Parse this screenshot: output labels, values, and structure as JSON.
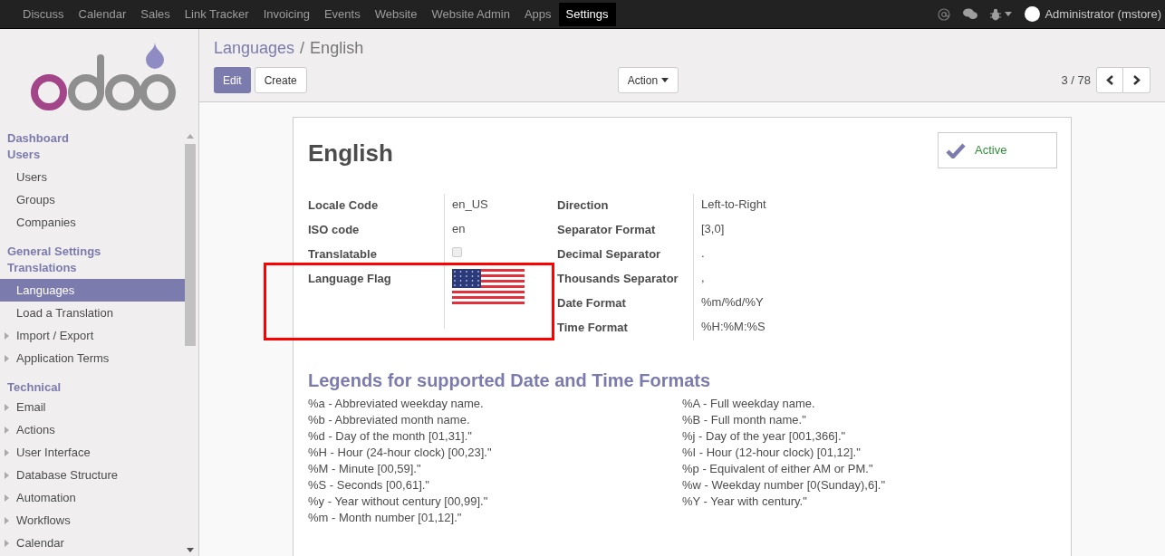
{
  "top_menu": [
    {
      "label": "Discuss",
      "selected": false
    },
    {
      "label": "Calendar",
      "selected": false
    },
    {
      "label": "Sales",
      "selected": false
    },
    {
      "label": "Link Tracker",
      "selected": false
    },
    {
      "label": "Invoicing",
      "selected": false
    },
    {
      "label": "Events",
      "selected": false
    },
    {
      "label": "Website",
      "selected": false
    },
    {
      "label": "Website Admin",
      "selected": false
    },
    {
      "label": "Apps",
      "selected": false
    },
    {
      "label": "Settings",
      "selected": true
    }
  ],
  "user": {
    "name": "Administrator (mstore)"
  },
  "sidebar": {
    "items": [
      {
        "kind": "header",
        "label": "Dashboard",
        "selected": false
      },
      {
        "kind": "header",
        "label": "Users",
        "selected": false
      },
      {
        "kind": "item",
        "label": "Users",
        "selected": false
      },
      {
        "kind": "item",
        "label": "Groups",
        "selected": false
      },
      {
        "kind": "item",
        "label": "Companies",
        "selected": false
      },
      {
        "kind": "header",
        "label": "General Settings",
        "selected": false
      },
      {
        "kind": "header",
        "label": "Translations",
        "selected": false
      },
      {
        "kind": "item",
        "label": "Languages",
        "selected": true
      },
      {
        "kind": "item",
        "label": "Load a Translation",
        "selected": false
      },
      {
        "kind": "folder",
        "label": "Import / Export",
        "selected": false
      },
      {
        "kind": "folder",
        "label": "Application Terms",
        "selected": false
      },
      {
        "kind": "header",
        "label": "Technical",
        "selected": false
      },
      {
        "kind": "folder",
        "label": "Email",
        "selected": false
      },
      {
        "kind": "folder",
        "label": "Actions",
        "selected": false
      },
      {
        "kind": "folder",
        "label": "User Interface",
        "selected": false
      },
      {
        "kind": "folder",
        "label": "Database Structure",
        "selected": false
      },
      {
        "kind": "folder",
        "label": "Automation",
        "selected": false
      },
      {
        "kind": "folder",
        "label": "Workflows",
        "selected": false
      },
      {
        "kind": "folder",
        "label": "Calendar",
        "selected": false
      }
    ]
  },
  "breadcrumb": [
    "Languages",
    "/",
    "English"
  ],
  "buttons": {
    "edit": "Edit",
    "create": "Create",
    "action": "Action"
  },
  "pager": "3 / 78",
  "record": {
    "title": "English",
    "active": {
      "label": "Active",
      "checked": true
    },
    "left_fields": [
      {
        "kind": "text",
        "label": "Locale Code",
        "value": "en_US"
      },
      {
        "kind": "text",
        "label": "ISO code",
        "value": "en"
      },
      {
        "kind": "checkbox",
        "label": "Translatable",
        "checked": false
      },
      {
        "kind": "flag",
        "label": "Language Flag"
      }
    ],
    "right_fields": [
      {
        "kind": "text",
        "label": "Direction",
        "value": "Left-to-Right"
      },
      {
        "kind": "text",
        "label": "Separator Format",
        "value": "[3,0]"
      },
      {
        "kind": "text",
        "label": "Decimal Separator",
        "value": "."
      },
      {
        "kind": "text",
        "label": "Thousands Separator",
        "value": ","
      },
      {
        "kind": "text",
        "label": "Date Format",
        "value": "%m/%d/%Y"
      },
      {
        "kind": "text",
        "label": "Time Format",
        "value": "%H:%M:%S"
      }
    ],
    "legend_title": "Legends for supported Date and Time Formats",
    "legend_left": [
      "%a - Abbreviated weekday name.",
      "%b - Abbreviated month name.",
      "%d - Day of the month [01,31].\"",
      "%H - Hour (24-hour clock) [00,23].\"",
      "%M - Minute [00,59].\"",
      "%S - Seconds [00,61].\"",
      "%y - Year without century [00,99].\"",
      "%m - Month number [01,12].\""
    ],
    "legend_right": [
      "%A - Full weekday name.",
      "%B - Full month name.\"",
      "%j - Day of the year [001,366].\"",
      "%I - Hour (12-hour clock) [01,12].\"",
      "%p - Equivalent of either AM or PM.\"",
      "%w - Weekday number [0(Sunday),6].\"",
      "%Y - Year with century.\""
    ]
  }
}
